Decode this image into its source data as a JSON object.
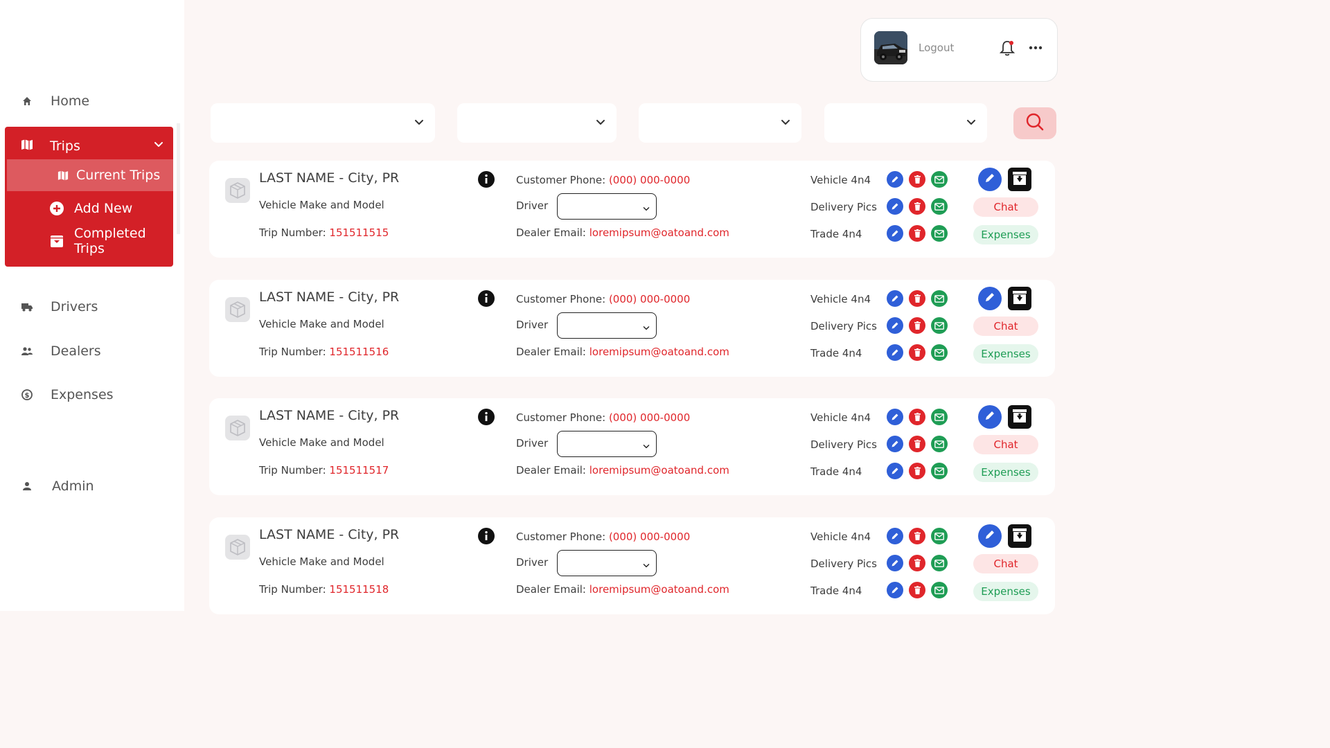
{
  "sidebar": {
    "items": [
      {
        "label": "Home",
        "icon": "home-icon"
      },
      {
        "label": "Trips",
        "icon": "map-icon",
        "sub": [
          {
            "label": "Current Trips",
            "icon": "map-icon",
            "active": true
          },
          {
            "label": "Add New",
            "icon": "plus-circle-icon"
          },
          {
            "label": "Completed Trips",
            "icon": "archive-icon"
          }
        ]
      },
      {
        "label": "Drivers",
        "icon": "truck-icon"
      },
      {
        "label": "Dealers",
        "icon": "users-icon"
      },
      {
        "label": "Expenses",
        "icon": "dollar-icon"
      },
      {
        "label": "Admin",
        "icon": "user-icon"
      }
    ]
  },
  "header": {
    "logout_label": "Logout"
  },
  "filters": [
    "",
    "",
    "",
    ""
  ],
  "card_labels": {
    "phone": "Customer Phone:",
    "driver": "Driver",
    "email": "Dealer Email:",
    "trip": "Trip Number:",
    "vehicle": "Vehicle 4n4",
    "delivery": "Delivery Pics",
    "trade": "Trade 4n4",
    "chat": "Chat",
    "expenses": "Expenses"
  },
  "trips": [
    {
      "title": "LAST NAME - City, PR",
      "model": "Vehicle Make and Model",
      "trip_number": "151511515",
      "phone": "(000) 000-0000",
      "email": "loremipsum@oatoand.com",
      "driver": ""
    },
    {
      "title": "LAST NAME - City, PR",
      "model": "Vehicle Make and Model",
      "trip_number": "151511516",
      "phone": "(000) 000-0000",
      "email": "loremipsum@oatoand.com",
      "driver": ""
    },
    {
      "title": "LAST NAME - City, PR",
      "model": "Vehicle Make and Model",
      "trip_number": "151511517",
      "phone": "(000) 000-0000",
      "email": "loremipsum@oatoand.com",
      "driver": ""
    },
    {
      "title": "LAST NAME - City, PR",
      "model": "Vehicle Make and Model",
      "trip_number": "151511518",
      "phone": "(000) 000-0000",
      "email": "loremipsum@oatoand.com",
      "driver": ""
    }
  ],
  "colors": {
    "brand": "#d32027",
    "active": "#dd5a5f",
    "blue": "#2f5fd8",
    "green": "#1f9d55",
    "red": "#e0262b"
  }
}
